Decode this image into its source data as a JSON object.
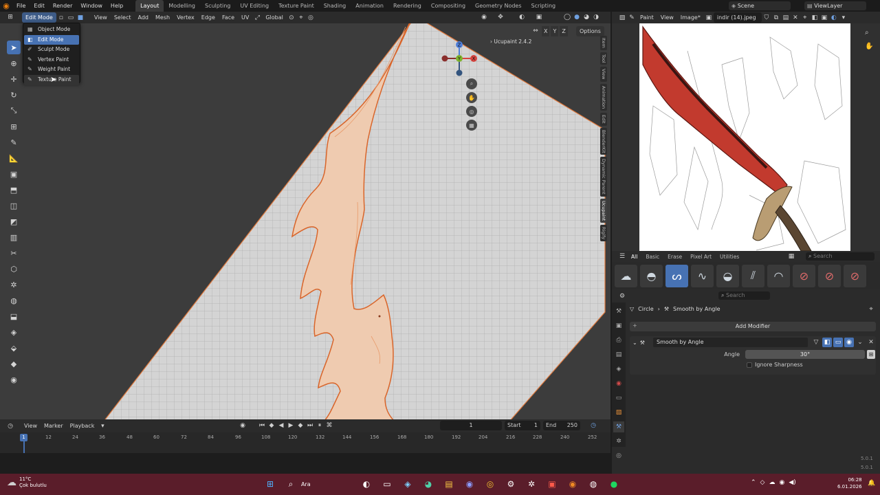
{
  "menus": [
    "File",
    "Edit",
    "Render",
    "Window",
    "Help"
  ],
  "workspaces": [
    "Layout",
    "Modelling",
    "Sculpting",
    "UV Editing",
    "Texture Paint",
    "Shading",
    "Animation",
    "Rendering",
    "Compositing",
    "Geometry Nodes",
    "Scripting"
  ],
  "scene": {
    "scene": "Scene",
    "view_layer": "ViewLayer"
  },
  "viewport_header": {
    "mode": "Edit Mode",
    "items": [
      "View",
      "Select",
      "Add",
      "Mesh",
      "Vertex",
      "Edge",
      "Face",
      "UV"
    ],
    "transform": "Global",
    "axes": [
      "X",
      "Y",
      "Z"
    ],
    "options": "Options"
  },
  "mode_menu": {
    "items": [
      "Object Mode",
      "Edit Mode",
      "Sculpt Mode",
      "Vertex Paint",
      "Weight Paint",
      "Texture Paint"
    ],
    "selected": "Edit Mode"
  },
  "overlay_label": "Ucupaint 2.4.2",
  "gizmo": {
    "z": "Z",
    "y": "Y",
    "x": "X"
  },
  "side_tabs": [
    "Item",
    "Tool",
    "View",
    "Animation",
    "Edit",
    "BlenderKit",
    "Dynamic Parent",
    "Ucupaint",
    "Rigify"
  ],
  "timeline": {
    "menus": [
      "View",
      "Marker",
      "Playback"
    ],
    "frame": "1",
    "start_label": "Start",
    "start": "1",
    "end_label": "End",
    "end": "250",
    "ticks": [
      "1",
      "12",
      "24",
      "36",
      "48",
      "60",
      "72",
      "84",
      "96",
      "108",
      "120",
      "132",
      "144",
      "156",
      "168",
      "180",
      "192",
      "204",
      "216",
      "228",
      "240",
      "252"
    ]
  },
  "image_editor": {
    "mode": "Paint",
    "menus": [
      "View",
      "Image*"
    ],
    "image_name": "indir (14).jpeg"
  },
  "brush_tabs": [
    "All",
    "Basic",
    "Erase",
    "Pixel Art",
    "Utilities"
  ],
  "brush_search": "Search",
  "props": {
    "search": "Search",
    "breadcrumb": [
      "Circle",
      "Smooth by Angle"
    ],
    "add_modifier": "Add Modifier",
    "modifier_name": "Smooth by Angle",
    "angle_label": "Angle",
    "angle_value": "30°",
    "ignore_sharpness": "Ignore Sharpness"
  },
  "version": "5.0.1",
  "taskbar": {
    "temp": "11°C",
    "weather": "Çok bulutlu",
    "search": "Ara",
    "time": "06:28",
    "date": "6.01.2026"
  },
  "colors": {
    "accent": "#4772b3",
    "uv_fill": "#efcbb0",
    "uv_edge": "#e0773a",
    "taskbar": "#5a1d2a"
  }
}
